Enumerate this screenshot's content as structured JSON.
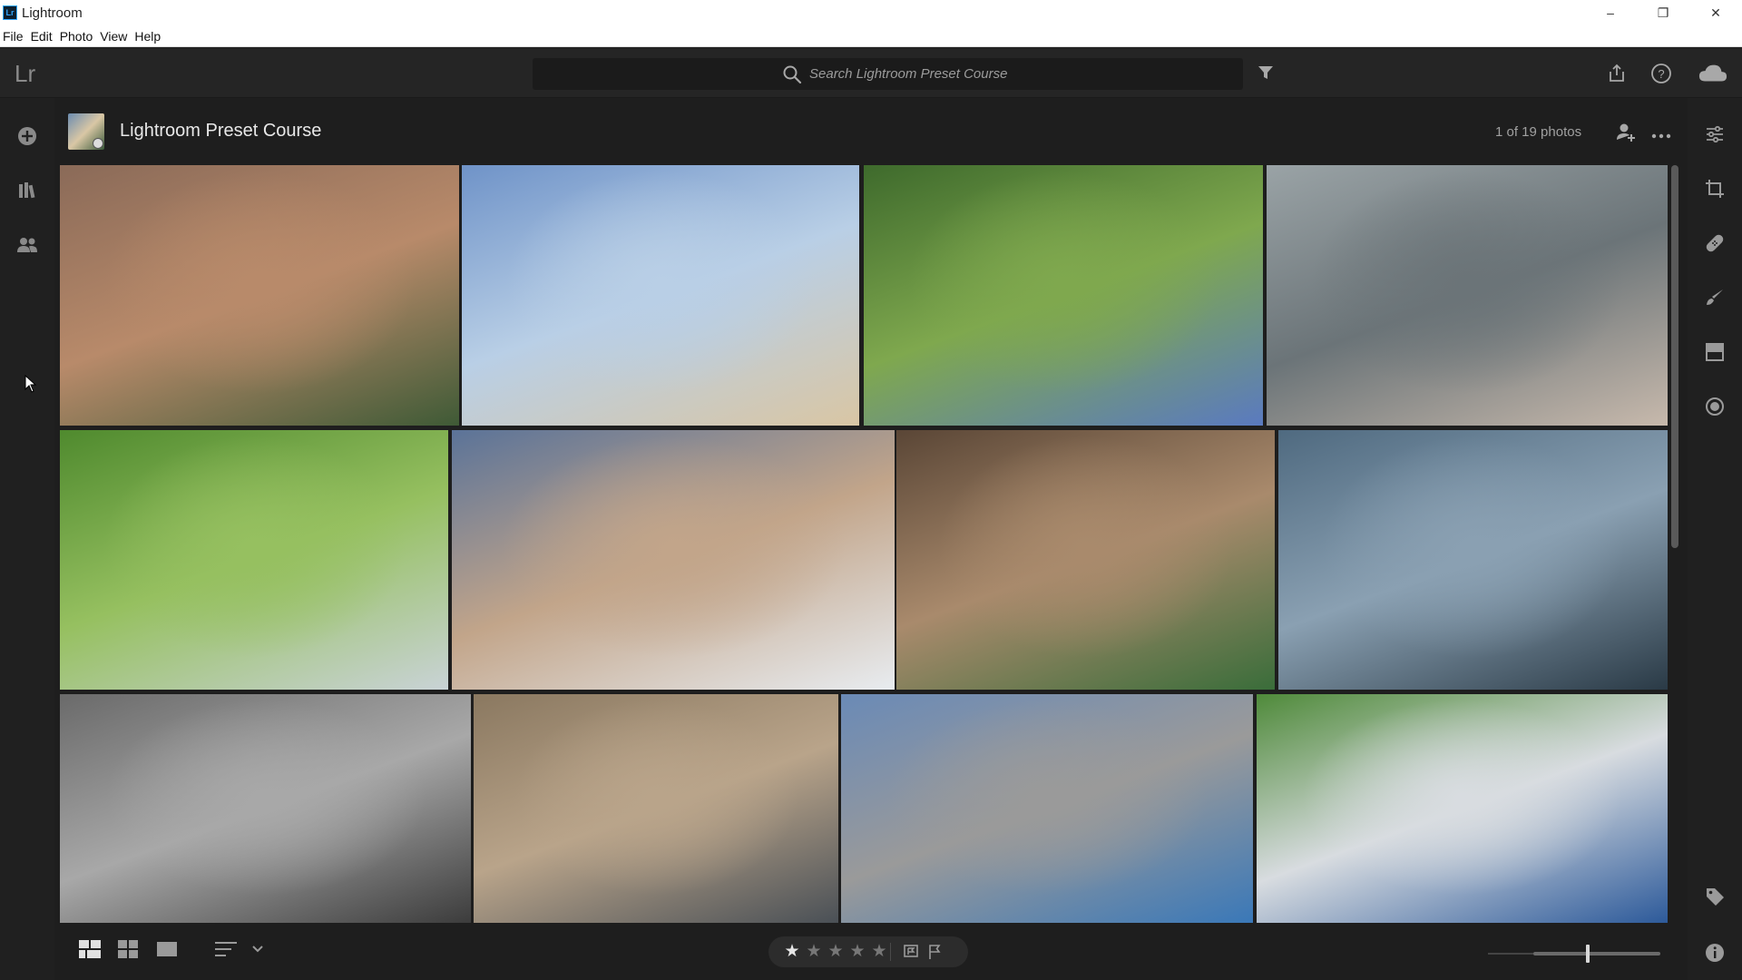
{
  "window": {
    "app_icon_text": "Lr",
    "title": "Lightroom",
    "minimize": "–",
    "restore": "❐",
    "close": "✕"
  },
  "menu": [
    "File",
    "Edit",
    "Photo",
    "View",
    "Help"
  ],
  "appbar": {
    "logo": "Lr",
    "search_placeholder": "Search Lightroom Preset Course"
  },
  "album": {
    "title": "Lightroom Preset Course",
    "count": "1 of 19 photos"
  },
  "rating": {
    "stars": 5,
    "filled": 1
  },
  "icons": {
    "left_rail": [
      "add-icon",
      "library-icon",
      "people-icon"
    ],
    "right_rail": [
      "edit-sliders-icon",
      "crop-icon",
      "healing-icon",
      "brush-icon",
      "linear-gradient-icon",
      "radial-gradient-icon",
      "keyword-tag-icon",
      "info-icon"
    ],
    "top_right": [
      "share-icon",
      "help-icon",
      "cloud-icon"
    ]
  },
  "photos": [
    {
      "name": "photo-friends-selfie",
      "colors": [
        "#8a6a58",
        "#b88a6a",
        "#3f5a36"
      ]
    },
    {
      "name": "photo-dog-beach",
      "colors": [
        "#6f93c8",
        "#b9cfe6",
        "#d9c6a4"
      ]
    },
    {
      "name": "photo-tug-of-war",
      "colors": [
        "#3e6a2c",
        "#7fa84e",
        "#5a7ac0"
      ]
    },
    {
      "name": "photo-woman-street",
      "colors": [
        "#9aa3a6",
        "#6b7478",
        "#c7b9ac"
      ]
    },
    {
      "name": "photo-woman-laptop-grass",
      "colors": [
        "#4f8a2e",
        "#96c060",
        "#c9d3d6"
      ]
    },
    {
      "name": "photo-mountain-meditation",
      "colors": [
        "#5b7398",
        "#c2a58a",
        "#e8ecf0"
      ]
    },
    {
      "name": "photo-food-table",
      "colors": [
        "#5a4636",
        "#a98a6c",
        "#3a6d3a"
      ]
    },
    {
      "name": "photo-man-camera",
      "colors": [
        "#4f6a80",
        "#8aa0b2",
        "#2a3a46"
      ]
    },
    {
      "name": "photo-couple-bikes",
      "colors": [
        "#6a6a6a",
        "#a8a8a8",
        "#3c3c3c"
      ]
    },
    {
      "name": "photo-skateboarder",
      "colors": [
        "#8a7860",
        "#b9a48a",
        "#4a5056"
      ]
    },
    {
      "name": "photo-sleeping-kitten",
      "colors": [
        "#6a8ab6",
        "#9a9a9a",
        "#3a78b8"
      ]
    },
    {
      "name": "photo-soccer-players",
      "colors": [
        "#4f8a3a",
        "#d8dce0",
        "#2d5a9a"
      ]
    }
  ]
}
